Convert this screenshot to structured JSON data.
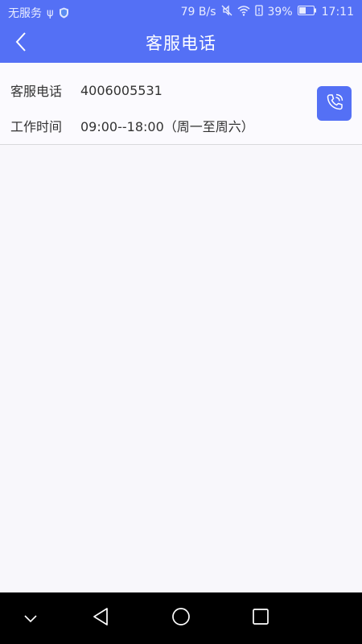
{
  "status_bar": {
    "carrier": "无服务",
    "network_speed": "79 B/s",
    "battery_percent": "39%",
    "time": "17:11",
    "icons": [
      "usb-icon",
      "shield-app-icon",
      "mute-icon",
      "wifi-icon",
      "sim-alert-icon",
      "battery-icon"
    ]
  },
  "header": {
    "title": "客服电话",
    "back_icon": "chevron-left-icon"
  },
  "contact": {
    "phone_label": "客服电话",
    "phone_value": "4006005531",
    "hours_label": "工作时间",
    "hours_value": "09:00--18:00（周一至周六）",
    "call_icon": "phone-call-icon"
  },
  "nav_bar": {
    "items": [
      "chevron-down-icon",
      "back-triangle-icon",
      "home-circle-icon",
      "recents-square-icon"
    ]
  },
  "colors": {
    "accent": "#5470f5",
    "background": "#f8f7fb",
    "nav_bar": "#000000"
  }
}
